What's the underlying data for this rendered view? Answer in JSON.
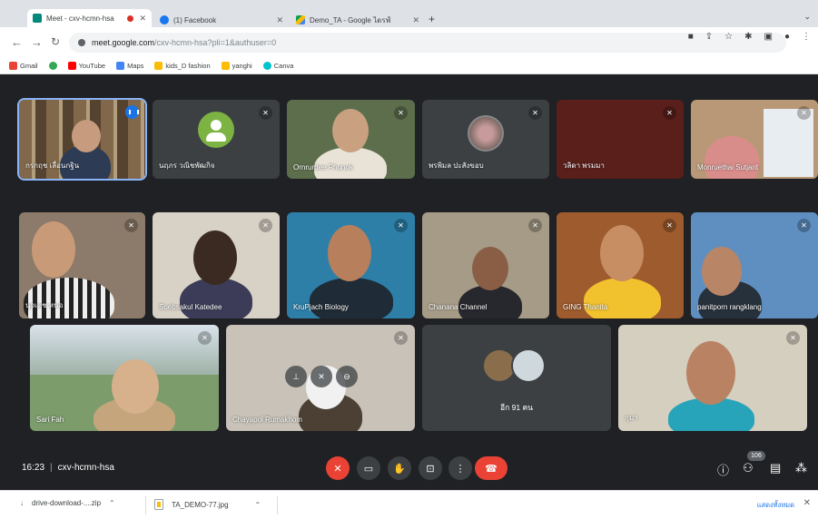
{
  "browser": {
    "tabs": [
      {
        "title": "Meet - cxv-hcmn-hsa",
        "icon": "meet-icon",
        "active": true
      },
      {
        "title": "(1) Facebook",
        "icon": "facebook-icon"
      },
      {
        "title": "Demo_TA - Google ไดรฟ์",
        "icon": "google-drive-icon"
      }
    ],
    "url_host": "meet.google.com",
    "url_path": "/cxv-hcmn-hsa?pli=1&authuser=0",
    "bookmarks": [
      {
        "label": "Gmail",
        "icon": "gmail-icon",
        "color": "#ea4335"
      },
      {
        "label": "",
        "icon": "chrome-icon",
        "color": "#34a853"
      },
      {
        "label": "YouTube",
        "icon": "youtube-icon",
        "color": "#ff0000"
      },
      {
        "label": "Maps",
        "icon": "maps-icon",
        "color": "#4285f4"
      },
      {
        "label": "kids_D fashion",
        "icon": "folder-icon",
        "color": "#fbbc04"
      },
      {
        "label": "yanghi",
        "icon": "folder-icon",
        "color": "#fbbc04"
      },
      {
        "label": "Canva",
        "icon": "canva-icon",
        "color": "#00c4cc"
      }
    ]
  },
  "meet": {
    "participants": [
      {
        "name": "กรกฤช เลื่อนกฐิน"
      },
      {
        "name": "นฤภร วณิชพัฒกิจ"
      },
      {
        "name": "Ornrurdee Phunok"
      },
      {
        "name": "พรพิมล ปะสังขอบ"
      },
      {
        "name": "วลิดา พรมมา"
      },
      {
        "name": "Monruethai Sutjarit"
      },
      {
        "name": "นุจเดช หน่อ"
      },
      {
        "name": "Suebsakul Katedee"
      },
      {
        "name": "KruPjach Biology"
      },
      {
        "name": "Chanana Channel"
      },
      {
        "name": "GING Thanita"
      },
      {
        "name": "panitporn rangklang"
      },
      {
        "name": "Sari Fah"
      },
      {
        "name": "Chayapol Rumakhom"
      },
      {
        "name": "กุมา"
      }
    ],
    "others_label": "อีก 91 คน",
    "time": "16:23",
    "meeting_code": "cxv-hcmn-hsa",
    "participant_count": "106"
  },
  "downloads": {
    "items": [
      {
        "name": "drive-download-....zip"
      },
      {
        "name": "TA_DEMO-77.jpg"
      }
    ],
    "show_all": "แสดงทั้งหมด"
  },
  "colors": {
    "background": "#202124",
    "tile": "#3c4043",
    "danger": "#ea4335",
    "accent": "#1a73e8"
  }
}
